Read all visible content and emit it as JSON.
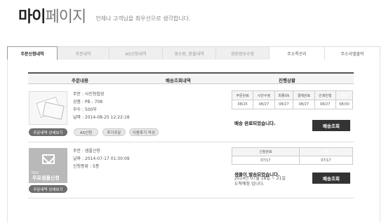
{
  "header": {
    "title_bold": "마이",
    "title_light": "페이지",
    "subtitle": "언제나 고객님을 최우선으로 생각합니다."
  },
  "tabs": [
    "주문신청내역",
    "주문내역",
    "AS신청내역",
    "영수증, 환불내역",
    "회원정보수정",
    "주소록관리",
    "주소라벨출력"
  ],
  "table_header": {
    "col1": "주문내용",
    "col2": "배송조회내역",
    "col3": "진행상황"
  },
  "order1": {
    "lines": [
      "주문 : 사진청첩장",
      "상품 : PB - 708",
      "부수 : 500부",
      "날짜 : 2014-08-25 12:22:18"
    ],
    "detail_button": "주문내역 상세보기",
    "as_button": "AS신청",
    "add_button": "추가주문",
    "review_button": "이용후기 작성",
    "steps": [
      "주문완료",
      "시안수정",
      "최종Ok",
      "결제완료",
      "인쇄진행",
      "발송"
    ],
    "dates": [
      "08/25",
      "08/27",
      "08/27",
      "08/27",
      "08/27",
      "08/30"
    ],
    "message": "배송 완료되었습니다.",
    "track_button": "배송조회"
  },
  "order2": {
    "thumb_small": "FREE",
    "thumb_label": "무료샘플신청",
    "lines": [
      "주문 : 샘플신청",
      "날짜 : 2014-07-17 01:30:09",
      "신청종류 : 5종"
    ],
    "detail_button": "주문내역 상세보기",
    "steps": [
      "신청완료",
      "발송"
    ],
    "dates": [
      "07/17",
      "07/17"
    ],
    "message_bold": "샘플이 발송되었습니다.",
    "message_line1": "2014년 07월 18일 ~ 21일",
    "message_line2": "도착예정 입니다.",
    "track_button": "배송조회"
  }
}
